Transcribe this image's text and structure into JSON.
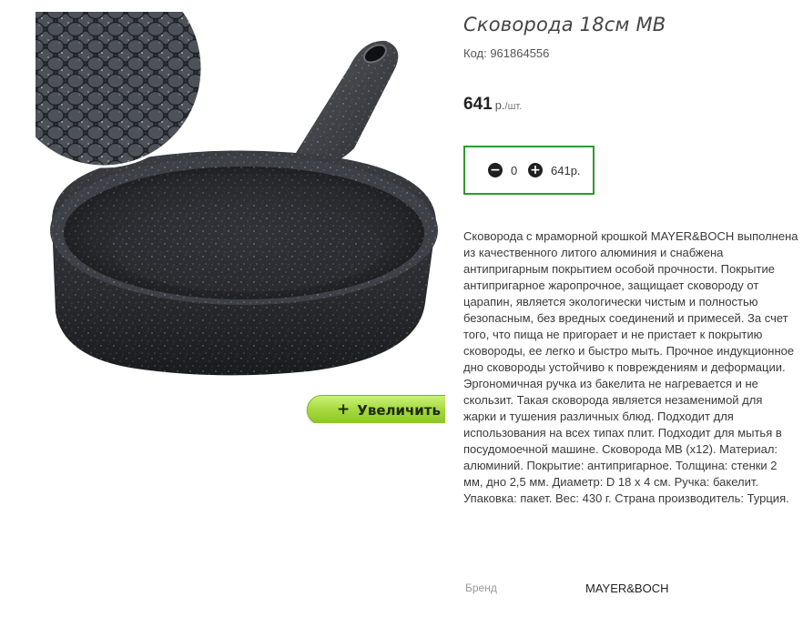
{
  "product": {
    "title": "Сковорода 18см MB",
    "code": "Код: 961864556",
    "price_value": "641",
    "price_unit": "р.",
    "price_per": "/шт.",
    "image_zoom_label": "Увеличить"
  },
  "quantity": {
    "minus_icon": "minus-circle-icon",
    "plus_icon": "plus-circle-icon",
    "value": "0",
    "total": "641р."
  },
  "description": "Сковорода с мраморной крошкой MAYER&BOCH выполнена из качественного литого алюминия и снабжена антипригарным покрытием особой прочности. Покрытие антипригарное жаропрочное, защищает сковороду от царапин, является экологически чистым и полностью безопасным, без вредных соединений и примесей. За счет того, что пища не пригорает и не пристает к покрытию сковороды, ее легко и быстро мыть. Прочное индукционное дно сковороды устойчиво к повреждениям и деформации. Эргономичная ручка из бакелита не нагревается и не скользит. Такая сковорода является незаменимой для жарки и тушения различных блюд. Подходит для использования на всех типах плит. Подходит для мытья в посудомоечной машине. Сковорода MB (х12). Материал: алюминий. Покрытие: антипригарное. Толщина: стенки 2 мм, дно 2,5 мм. Диаметр: D 18 х 4 см. Ручка: бакелит. Упаковка: пакет. Вес: 430 г. Страна производитель: Турция.",
  "brand": {
    "label": "Бренд",
    "value": "MAYER&BOCH"
  },
  "colors": {
    "accent_border": "#2e9c2a",
    "zoom_button": "#a4d93d",
    "pan_body": "#2b2d31"
  }
}
